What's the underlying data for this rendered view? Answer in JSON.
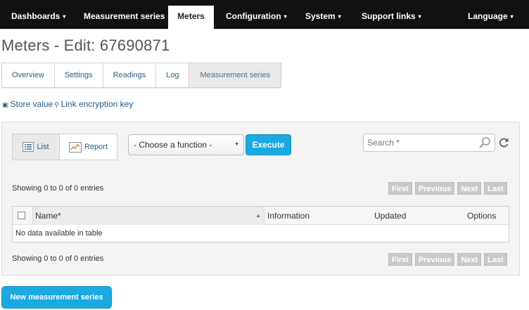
{
  "nav": {
    "items": [
      {
        "label": "Dashboards",
        "caret": true
      },
      {
        "label": "Measurement series",
        "caret": false
      },
      {
        "label": "Meters",
        "caret": false
      },
      {
        "label": "Configuration",
        "caret": true
      },
      {
        "label": "System",
        "caret": true
      },
      {
        "label": "Support links",
        "caret": true
      },
      {
        "label": "Language",
        "caret": true
      }
    ],
    "active_index": 2
  },
  "page": {
    "title": "Meters - Edit: 67690871"
  },
  "tabs": [
    {
      "label": "Overview"
    },
    {
      "label": "Settings"
    },
    {
      "label": "Readings"
    },
    {
      "label": "Log"
    },
    {
      "label": "Measurement series",
      "active": true
    }
  ],
  "actions": {
    "store_value": "Store value",
    "link_key": "Link encryption key"
  },
  "toolbar": {
    "list_label": "List",
    "report_label": "Report",
    "function_select": "- Choose a function -",
    "execute_label": "Execute",
    "search_placeholder": "Search *"
  },
  "table": {
    "info_top": "Showing 0 to 0 of 0 entries",
    "info_bottom": "Showing 0 to 0 of 0 entries",
    "pager": [
      "First",
      "Previous",
      "Next",
      "Last"
    ],
    "columns": [
      "Name*",
      "Information",
      "Updated",
      "Options"
    ],
    "empty_message": "No data available in table"
  },
  "footer": {
    "new_button": "New measurement series"
  },
  "colors": {
    "accent": "#1aa9e0",
    "nav_bg": "#111111",
    "link": "#1e5b8c"
  }
}
